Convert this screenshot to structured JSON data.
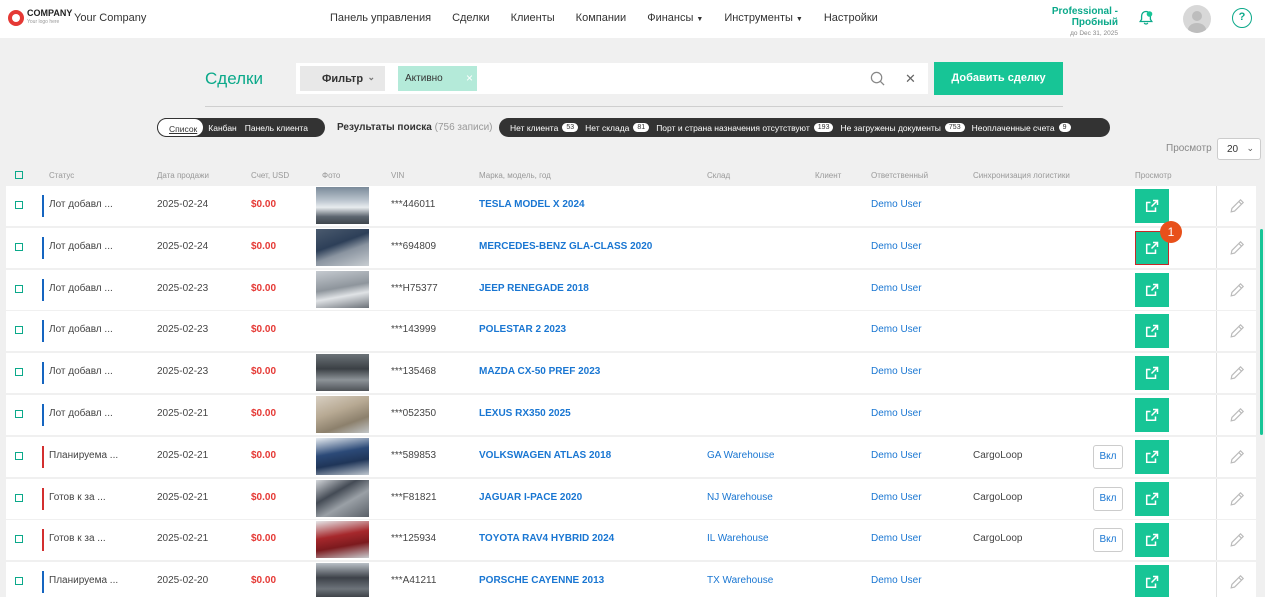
{
  "brand": {
    "logo_line1": "COMPANY",
    "logo_line2": "Your logo here",
    "company_name": "Your Company"
  },
  "nav": [
    {
      "label": "Панель управления",
      "active": false,
      "dropdown": false
    },
    {
      "label": "Сделки",
      "active": true,
      "dropdown": false
    },
    {
      "label": "Клиенты",
      "active": false,
      "dropdown": false
    },
    {
      "label": "Компании",
      "active": false,
      "dropdown": false
    },
    {
      "label": "Финансы",
      "active": false,
      "dropdown": true
    },
    {
      "label": "Инструменты",
      "active": false,
      "dropdown": true
    },
    {
      "label": "Настройки",
      "active": false,
      "dropdown": false
    }
  ],
  "plan": {
    "name": "Professional - Пробный",
    "until": "до Dec 31, 2025"
  },
  "help_label": "?",
  "page": {
    "title": "Сделки",
    "filter_label": "Фильтр",
    "active_tag": "Активно",
    "add_button": "Добавить сделку"
  },
  "view_toggle": {
    "list": "Список",
    "kanban": "Канбан",
    "client_panel": "Панель клиента"
  },
  "results": {
    "label": "Результаты поиска",
    "count": "(756 записи)"
  },
  "chips": [
    {
      "label": "Нет клиента",
      "count": "53"
    },
    {
      "label": "Нет склада",
      "count": "81"
    },
    {
      "label": "Порт и страна назначения отсутствуют",
      "count": "193"
    },
    {
      "label": "Не загружены документы",
      "count": "753"
    },
    {
      "label": "Неоплаченные счета",
      "count": "9"
    }
  ],
  "per_page": {
    "label": "Просмотр",
    "value": "20"
  },
  "columns": {
    "status": "Статус",
    "date": "Дата продажи",
    "invoice": "Счет, USD",
    "photo": "Фото",
    "vin": "VIN",
    "model": "Марка, модель, год",
    "warehouse": "Склад",
    "client": "Клиент",
    "responsible": "Ответственный",
    "sync": "Синхронизация логистики",
    "view": "Просмотр"
  },
  "rows": [
    {
      "status": "Лот добавл ...",
      "status_color": "#1565c0",
      "date": "2025-02-24",
      "price": "$0.00",
      "photo": "p1",
      "vin": "***446011",
      "model": "TESLA MODEL X 2024",
      "warehouse": "",
      "responsible": "Demo User",
      "sync": "",
      "toggle": ""
    },
    {
      "status": "Лот добавл ...",
      "status_color": "#1565c0",
      "date": "2025-02-24",
      "price": "$0.00",
      "photo": "p2",
      "vin": "***694809",
      "model": "MERCEDES-BENZ GLA-CLASS 2020",
      "warehouse": "",
      "responsible": "Demo User",
      "sync": "",
      "toggle": ""
    },
    {
      "status": "Лот добавл ...",
      "status_color": "#1565c0",
      "date": "2025-02-23",
      "price": "$0.00",
      "photo": "p3",
      "vin": "***H75377",
      "model": "JEEP RENEGADE 2018",
      "warehouse": "",
      "responsible": "Demo User",
      "sync": "",
      "toggle": ""
    },
    {
      "status": "Лот добавл ...",
      "status_color": "#1565c0",
      "date": "2025-02-23",
      "price": "$0.00",
      "photo": "",
      "vin": "***143999",
      "model": "POLESTAR 2 2023",
      "warehouse": "",
      "responsible": "Demo User",
      "sync": "",
      "toggle": ""
    },
    {
      "status": "Лот добавл ...",
      "status_color": "#1565c0",
      "date": "2025-02-23",
      "price": "$0.00",
      "photo": "p4",
      "vin": "***135468",
      "model": "MAZDA CX-50 PREF 2023",
      "warehouse": "",
      "responsible": "Demo User",
      "sync": "",
      "toggle": ""
    },
    {
      "status": "Лот добавл ...",
      "status_color": "#1565c0",
      "date": "2025-02-21",
      "price": "$0.00",
      "photo": "p5",
      "vin": "***052350",
      "model": "LEXUS RX350 2025",
      "warehouse": "",
      "responsible": "Demo User",
      "sync": "",
      "toggle": ""
    },
    {
      "status": "Планируема ...",
      "status_color": "#d32f2f",
      "date": "2025-02-21",
      "price": "$0.00",
      "photo": "p6",
      "vin": "***589853",
      "model": "VOLKSWAGEN ATLAS 2018",
      "warehouse": "GA Warehouse",
      "responsible": "Demo User",
      "sync": "CargoLoop",
      "toggle": "Вкл"
    },
    {
      "status": "Готов к за ...",
      "status_color": "#d32f2f",
      "date": "2025-02-21",
      "price": "$0.00",
      "photo": "p7",
      "vin": "***F81821",
      "model": "JAGUAR I-PACE 2020",
      "warehouse": "NJ Warehouse",
      "responsible": "Demo User",
      "sync": "CargoLoop",
      "toggle": "Вкл"
    },
    {
      "status": "Готов к за ...",
      "status_color": "#d32f2f",
      "date": "2025-02-21",
      "price": "$0.00",
      "photo": "p8",
      "vin": "***125934",
      "model": "TOYOTA RAV4 HYBRID 2024",
      "warehouse": "IL Warehouse",
      "responsible": "Demo User",
      "sync": "CargoLoop",
      "toggle": "Вкл"
    },
    {
      "status": "Планируема ...",
      "status_color": "#1565c0",
      "date": "2025-02-20",
      "price": "$0.00",
      "photo": "p9",
      "vin": "***A41211",
      "model": "PORSCHE CAYENNE 2013",
      "warehouse": "TX Warehouse",
      "responsible": "Demo User",
      "sync": "",
      "toggle": ""
    }
  ],
  "annotation_marker": "1",
  "colors": {
    "accent": "#0ba98a",
    "button": "#17c596",
    "price": "#e53935",
    "link": "#1976d2"
  }
}
